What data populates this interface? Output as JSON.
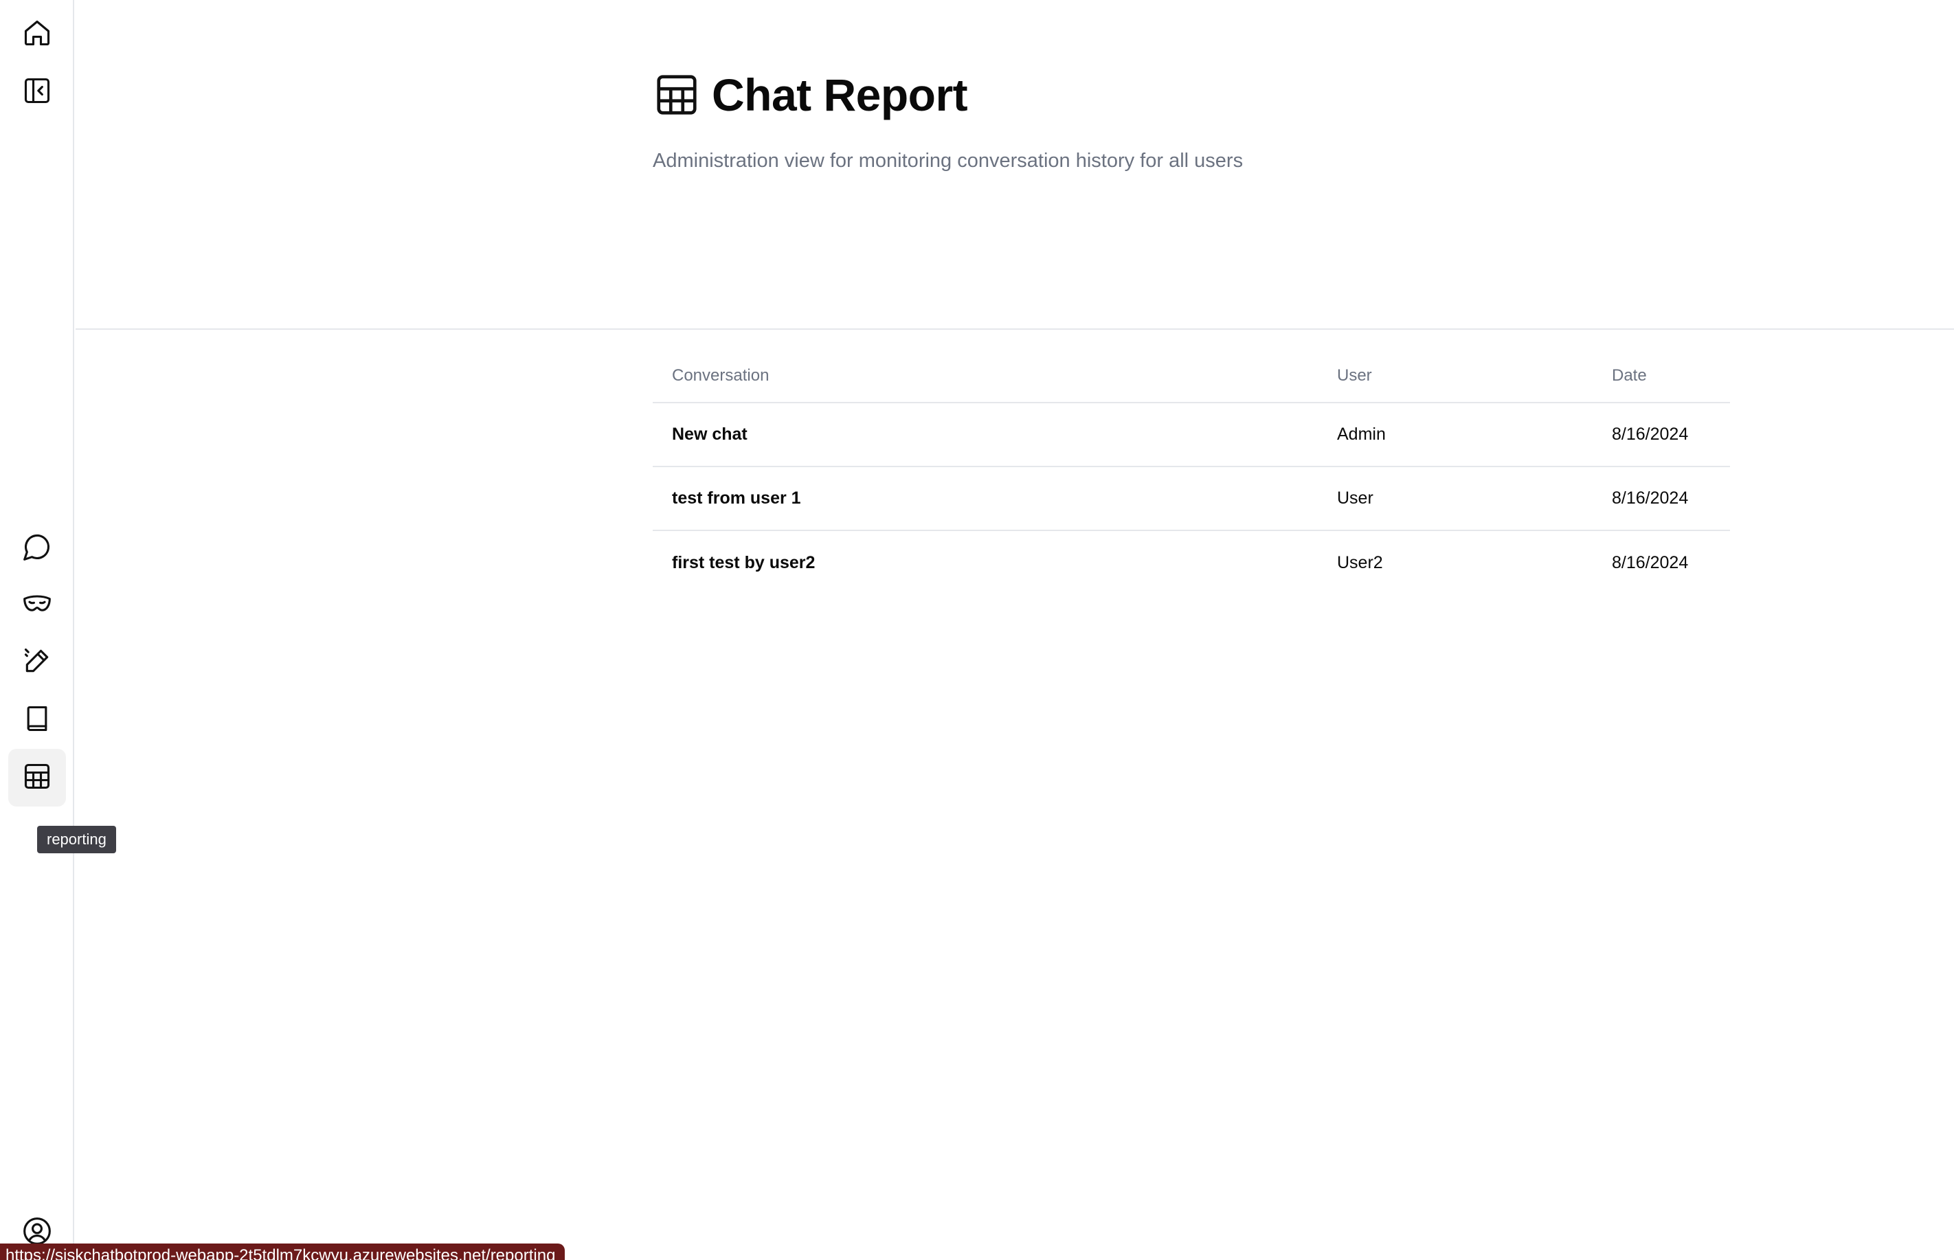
{
  "sidebar": {
    "items": [
      {
        "name": "home",
        "icon": "home-icon"
      },
      {
        "name": "collapse-sidebar",
        "icon": "sidebar-collapse-icon"
      },
      {
        "name": "chat",
        "icon": "chat-bubble-icon"
      },
      {
        "name": "personas",
        "icon": "mask-icon"
      },
      {
        "name": "prompts",
        "icon": "pen-icon"
      },
      {
        "name": "library",
        "icon": "book-icon"
      },
      {
        "name": "reporting",
        "icon": "table-icon"
      },
      {
        "name": "profile",
        "icon": "user-circle-icon"
      }
    ],
    "active": "reporting",
    "tooltip": "reporting"
  },
  "header": {
    "title": "Chat Report",
    "subtitle": "Administration view for monitoring conversation history for all users",
    "icon": "table-icon"
  },
  "table": {
    "columns": [
      "Conversation",
      "User",
      "Date"
    ],
    "rows": [
      {
        "conversation": "New chat",
        "user": "Admin",
        "date": "8/16/2024"
      },
      {
        "conversation": "test from user 1",
        "user": "User",
        "date": "8/16/2024"
      },
      {
        "conversation": "first test by user2",
        "user": "User2",
        "date": "8/16/2024"
      }
    ]
  },
  "status_bar": {
    "url": "https://siskchatbotprod-webapp-2t5tdlm7kcwyu.azurewebsites.net/reporting"
  },
  "colors": {
    "text": "#0a0a0a",
    "muted": "#6b7280",
    "border": "#e5e7eb",
    "active_bg": "#f2f2f2",
    "tooltip_bg": "#3f3f46",
    "status_bg": "#6b1a1a"
  }
}
